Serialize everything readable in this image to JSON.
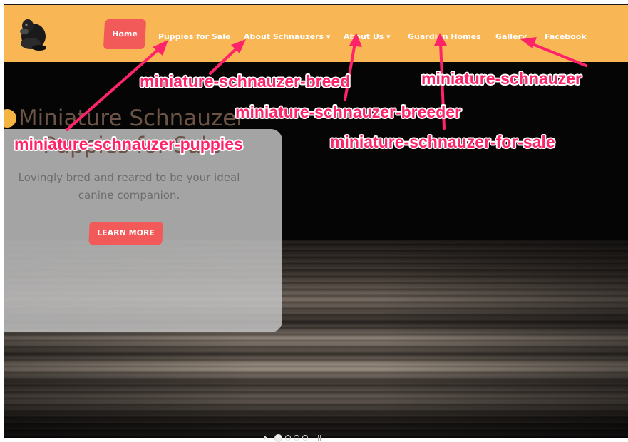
{
  "nav": {
    "home": "Home",
    "puppies": "Puppies for Sale",
    "about_schnauzers": "About Schnauzers ▾",
    "about_us": "About Us ▾",
    "guardian": "Guardian Homes",
    "gallery": "Gallery",
    "facebook": "Facebook"
  },
  "hero": {
    "title_line1": "Miniature Schnauzer",
    "title_line2": "Puppies for Sale",
    "sub_line1": "Lovingly bred and reared to be your ideal",
    "sub_line2": "canine companion.",
    "button": "LEARN MORE"
  },
  "annotations": {
    "breed": "miniature-schnauzer-breed",
    "schnauzer": "miniature-schnauzer",
    "breeder": "miniature-schnauzer-breeder",
    "puppies": "miniature-schnauzer-puppies",
    "for_sale": "miniature-schnauzer-for-sale"
  },
  "carousel": {
    "slides": 4,
    "active": 1
  },
  "colors": {
    "nav_bg": "#f8b655",
    "accent": "#f25a5a",
    "annotation": "#ff2469"
  }
}
